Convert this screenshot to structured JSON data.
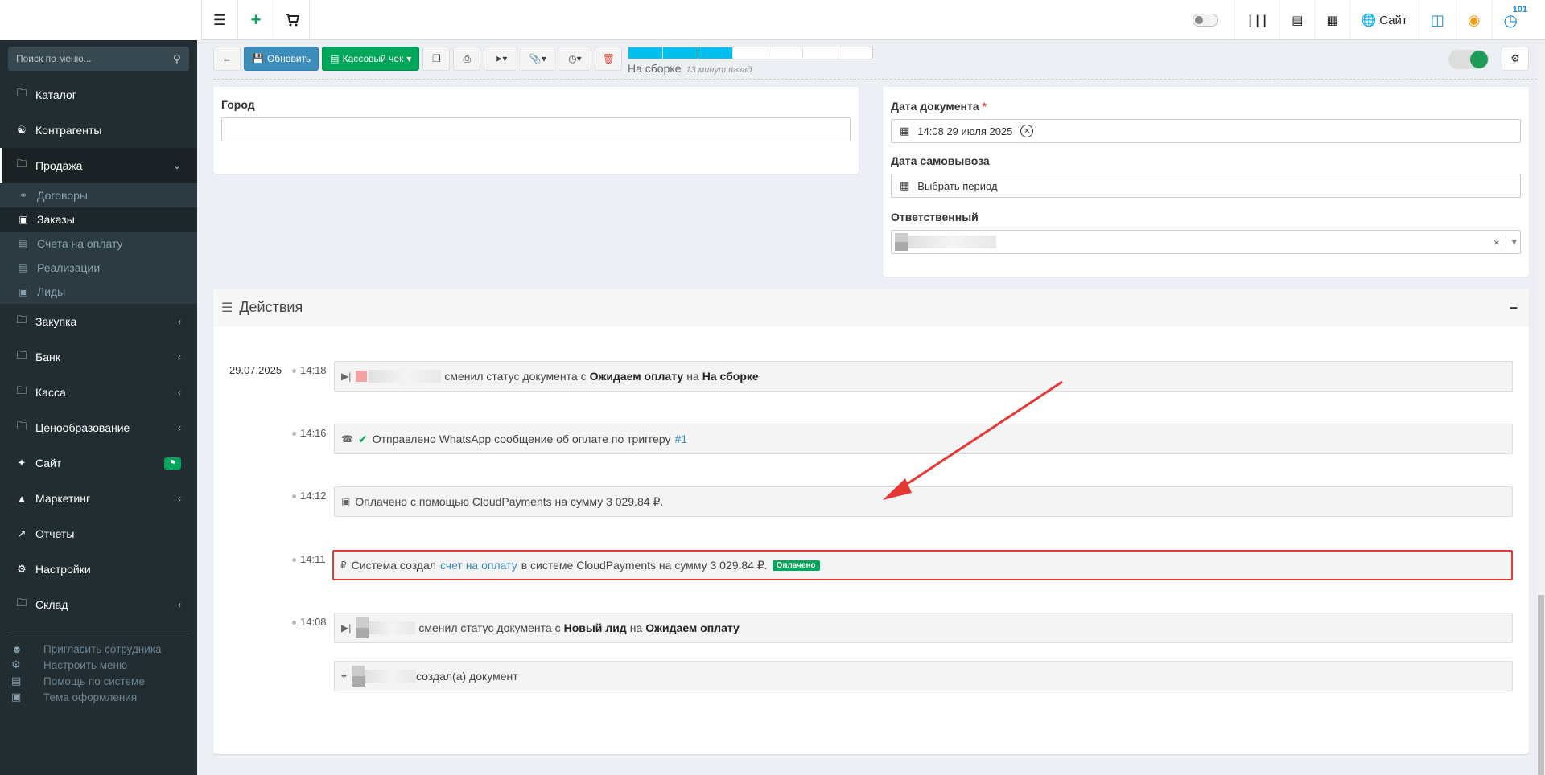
{
  "topbar": {
    "left_icons": [
      "menu-icon",
      "plus-icon",
      "cart-icon"
    ],
    "right": {
      "site_label": "Сайт",
      "notifications_count": "101"
    }
  },
  "sidebar": {
    "search_placeholder": "Поиск по меню...",
    "items": [
      {
        "label": "Каталог",
        "icon": "folder-icon"
      },
      {
        "label": "Контрагенты",
        "icon": "users-icon"
      },
      {
        "label": "Продажа",
        "icon": "folder-icon",
        "expanded": true
      },
      {
        "label": "Закупка",
        "icon": "folder-icon"
      },
      {
        "label": "Банк",
        "icon": "folder-icon"
      },
      {
        "label": "Касса",
        "icon": "folder-icon"
      },
      {
        "label": "Ценообразование",
        "icon": "folder-icon"
      },
      {
        "label": "Сайт",
        "icon": "magic-icon"
      },
      {
        "label": "Маркетинг",
        "icon": "chart-area-icon"
      },
      {
        "label": "Отчеты",
        "icon": "line-chart-icon"
      },
      {
        "label": "Настройки",
        "icon": "gear-icon"
      },
      {
        "label": "Склад",
        "icon": "folder-icon"
      }
    ],
    "sub_items": [
      {
        "label": "Договоры",
        "icon": "handshake-icon"
      },
      {
        "label": "Заказы",
        "icon": "basket-icon"
      },
      {
        "label": "Счета на оплату",
        "icon": "file-icon"
      },
      {
        "label": "Реализации",
        "icon": "list-icon"
      },
      {
        "label": "Лиды",
        "icon": "contact-icon"
      }
    ],
    "footer": [
      {
        "label": "Пригласить сотрудника",
        "icon": "user-plus-icon"
      },
      {
        "label": "Настроить меню",
        "icon": "cogs-icon"
      },
      {
        "label": "Помощь по системе",
        "icon": "book-icon"
      },
      {
        "label": "Тема оформления",
        "icon": "image-icon"
      }
    ]
  },
  "toolbar": {
    "refresh_label": "Обновить",
    "receipt_label": "Кассовый чек",
    "status_label": "На сборке",
    "status_time": "13 минут назад",
    "progress": {
      "filled": 3,
      "total": 7
    }
  },
  "form": {
    "city_label": "Город",
    "city_value": "",
    "doc_date_label": "Дата документа",
    "doc_date_required": "*",
    "doc_date_value": "14:08 29 июля 2025",
    "pickup_label": "Дата самовывоза",
    "pickup_placeholder": "Выбрать период",
    "responsible_label": "Ответственный"
  },
  "actions": {
    "title": "Действия",
    "date": "29.07.2025",
    "events": [
      {
        "time": "14:18",
        "pre": "сменил статус документа с",
        "from": "Ожидаем оплату",
        "mid": "на",
        "to": "На сборке"
      },
      {
        "time": "14:16",
        "text": "Отправлено WhatsApp сообщение об оплате по триггеру",
        "link": "#1"
      },
      {
        "time": "14:12",
        "text": "Оплачено с помощью CloudPayments на сумму 3 029.84 ₽."
      },
      {
        "time": "14:11",
        "pre": "Система создал",
        "link": "счет на оплату",
        "post": "в системе CloudPayments на сумму 3 029.84 ₽.",
        "badge": "Оплачено"
      },
      {
        "time": "14:08",
        "pre": "сменил статус документа с",
        "from": "Новый лид",
        "mid": "на",
        "to": "Ожидаем оплату"
      },
      {
        "time": "",
        "text": "создал(а) документ"
      }
    ]
  },
  "colors": {
    "sidebar_bg": "#222d32",
    "primary": "#3c8dbc",
    "success": "#00a65a",
    "highlight": "#e53935",
    "progress_fill": "#00c0ef"
  }
}
